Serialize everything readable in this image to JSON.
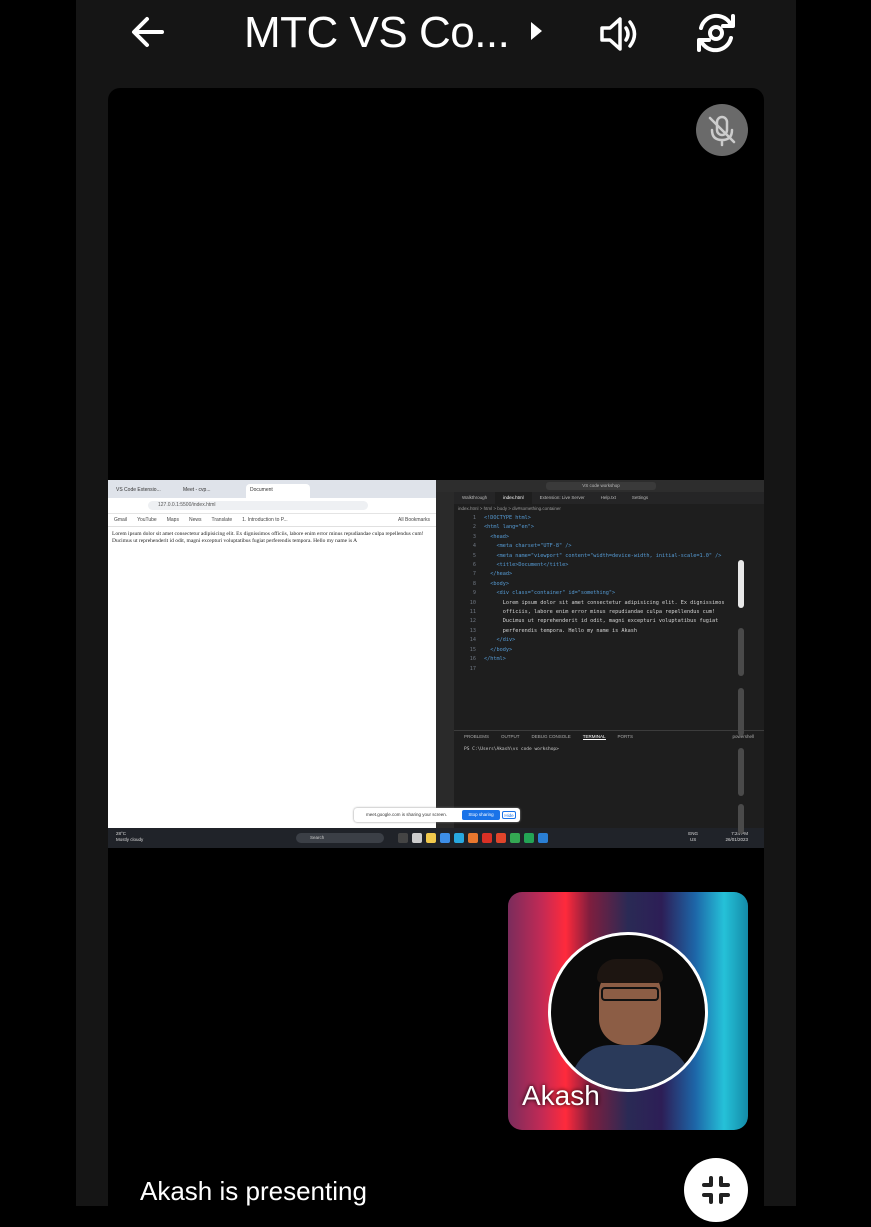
{
  "header": {
    "title": "MTC VS Co...",
    "back_icon": "arrow-left-icon",
    "audio_icon": "speaker-icon",
    "camera_icon": "camera-switch-icon"
  },
  "stage": {
    "mute_icon": "mic-off-icon"
  },
  "shared_screen": {
    "browser": {
      "tabs": [
        "VS Code Extensio...",
        "Meet - cvp...",
        "Document"
      ],
      "url": "127.0.0.1:5500/index.html",
      "bookmarks": [
        "Gmail",
        "YouTube",
        "Maps",
        "News",
        "Translate",
        "1. Introduction to P...",
        "All Bookmarks"
      ],
      "body_text": "Lorem ipsum dolor sit amet consectetur adipisicing elit. Ex dignissimos officiis, labore enim error minus repudiandae culpa repellendus cum! Ducimus ut reprehenderit id odit, magni excepturi voluptatibus fugiat perferendis tempora. Hello my name is A"
    },
    "vscode": {
      "search": "VS code workshop",
      "tabs": [
        "Walkthrough",
        "index.html",
        "Extension: Live Server",
        "Help.txt",
        "Settings"
      ],
      "breadcrumb": "index.html > html > body > div#something.container",
      "lines": [
        {
          "n": "1",
          "t": "<!DOCTYPE html>"
        },
        {
          "n": "2",
          "t": "<html lang=\"en\">"
        },
        {
          "n": "3",
          "t": "  <head>"
        },
        {
          "n": "4",
          "t": "    <meta charset=\"UTF-8\" />"
        },
        {
          "n": "5",
          "t": "    <meta name=\"viewport\" content=\"width=device-width, initial-scale=1.0\" />"
        },
        {
          "n": "6",
          "t": "    <title>Document</title>"
        },
        {
          "n": "7",
          "t": "  </head>"
        },
        {
          "n": "8",
          "t": "  <body>"
        },
        {
          "n": "9",
          "t": "    <div class=\"container\" id=\"something\">"
        },
        {
          "n": "10",
          "t": "      Lorem ipsum dolor sit amet consectetur adipisicing elit. Ex dignissimos"
        },
        {
          "n": "11",
          "t": "      officiis, labore enim error minus repudiandae culpa repellendus cum!"
        },
        {
          "n": "12",
          "t": "      Ducimus ut reprehenderit id odit, magni excepturi voluptatibus fugiat"
        },
        {
          "n": "13",
          "t": "      perferendis tempora. Hello my name is Akash"
        },
        {
          "n": "14",
          "t": "    </div>"
        },
        {
          "n": "15",
          "t": "  </body>"
        },
        {
          "n": "16",
          "t": "</html>"
        },
        {
          "n": "17",
          "t": ""
        }
      ],
      "panel_tabs": [
        "PROBLEMS",
        "OUTPUT",
        "DEBUG CONSOLE",
        "TERMINAL",
        "PORTS"
      ],
      "terminal_label": "powershell",
      "terminal_line": "PS C:\\Users\\Akash\\vs code workshop>"
    },
    "share_notice": {
      "text": "meet.google.com is sharing your screen.",
      "stop": "Stop sharing",
      "hide": "Hide"
    },
    "taskbar": {
      "weather_temp": "28°C",
      "weather_desc": "Mostly cloudy",
      "search": "Search",
      "lang_top": "ENG",
      "lang_bottom": "US",
      "time": "7:24 PM",
      "date": "26/01/2023"
    }
  },
  "participant": {
    "name": "Akash"
  },
  "footer": {
    "status": "Akash is presenting",
    "fullscreen_icon": "exit-fullscreen-icon"
  }
}
